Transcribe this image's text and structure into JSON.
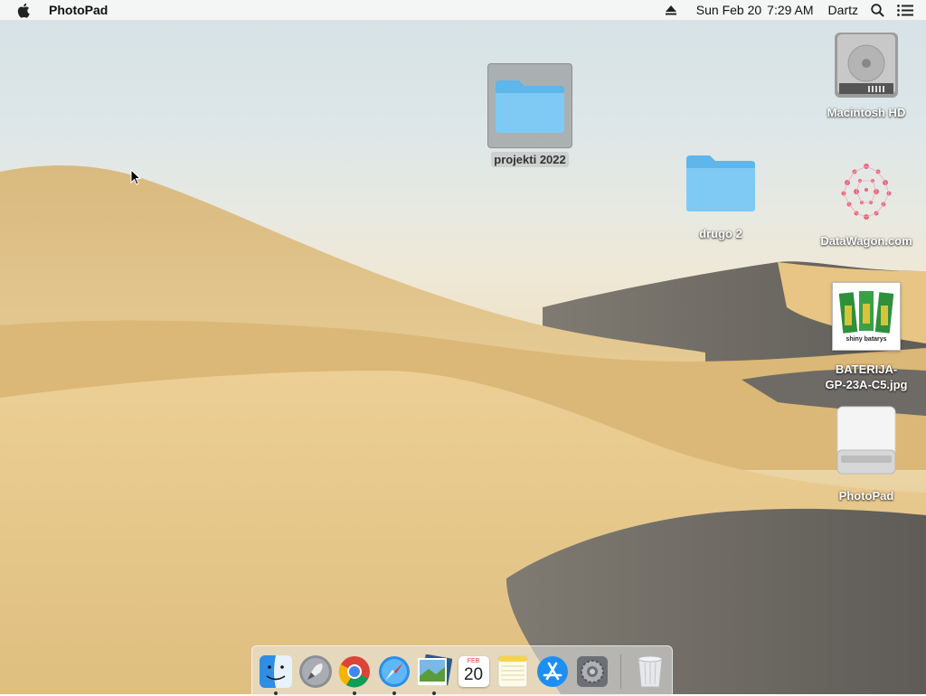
{
  "menubar": {
    "app_name": "PhotoPad",
    "date": "Sun Feb 20",
    "time": "7:29 AM",
    "user": "Dartz",
    "icons": [
      "apple-icon",
      "eject-icon",
      "spotlight-search-icon",
      "notification-center-icon"
    ]
  },
  "desktop": {
    "icons": [
      {
        "label": "projekti 2022",
        "type": "folder",
        "selected": true
      },
      {
        "label": "drugo 2",
        "type": "folder",
        "selected": false
      },
      {
        "label": "Macintosh HD",
        "type": "hard-drive"
      },
      {
        "label": "DataWagon.com",
        "type": "image-file"
      },
      {
        "label_line1": "BATERIJA-",
        "label_line2": "GP-23A-C5.jpg",
        "type": "image-file",
        "thumb_text": "shiny batarys"
      },
      {
        "label": "PhotoPad",
        "type": "external-drive"
      }
    ]
  },
  "dock": {
    "items": [
      {
        "name": "Finder",
        "running": true
      },
      {
        "name": "Launchpad",
        "running": false
      },
      {
        "name": "Google Chrome",
        "running": true
      },
      {
        "name": "Safari",
        "running": true
      },
      {
        "name": "Preview",
        "running": true
      },
      {
        "name": "Calendar",
        "running": false,
        "month": "FEB",
        "day": "20"
      },
      {
        "name": "Notes",
        "running": false
      },
      {
        "name": "App Store",
        "running": false
      },
      {
        "name": "System Preferences",
        "running": false
      },
      {
        "name": "Trash",
        "running": false
      }
    ]
  },
  "colors": {
    "folder_blue": "#6cc3f2",
    "menubar_bg": "#f6f6f6",
    "sand": "#e6c68a",
    "sky": "#d8e4e8"
  }
}
